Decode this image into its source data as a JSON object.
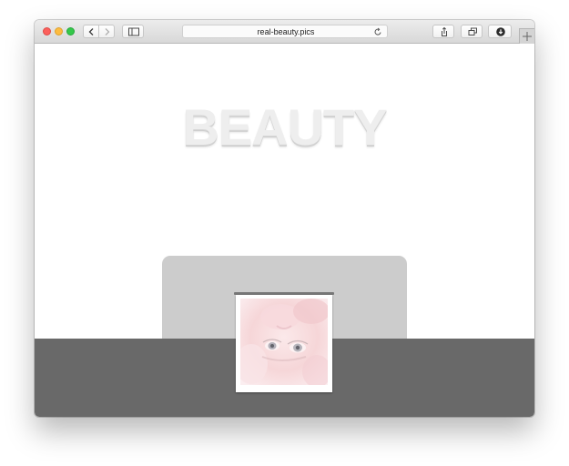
{
  "browser": {
    "url": "real-beauty.pics",
    "icons": {
      "back": "chevron-left-icon",
      "forward": "chevron-right-icon",
      "sidebar": "sidebar-icon",
      "reload": "reload-icon",
      "share": "share-icon",
      "tabs": "tabs-overview-icon",
      "download": "download-icon",
      "new_tab": "plus-icon"
    }
  },
  "page": {
    "headline": "BEAUTY",
    "colors": {
      "headline": "#eeeeee",
      "stage": "#cccccc",
      "floor": "#696969",
      "rod": "#777777"
    }
  }
}
